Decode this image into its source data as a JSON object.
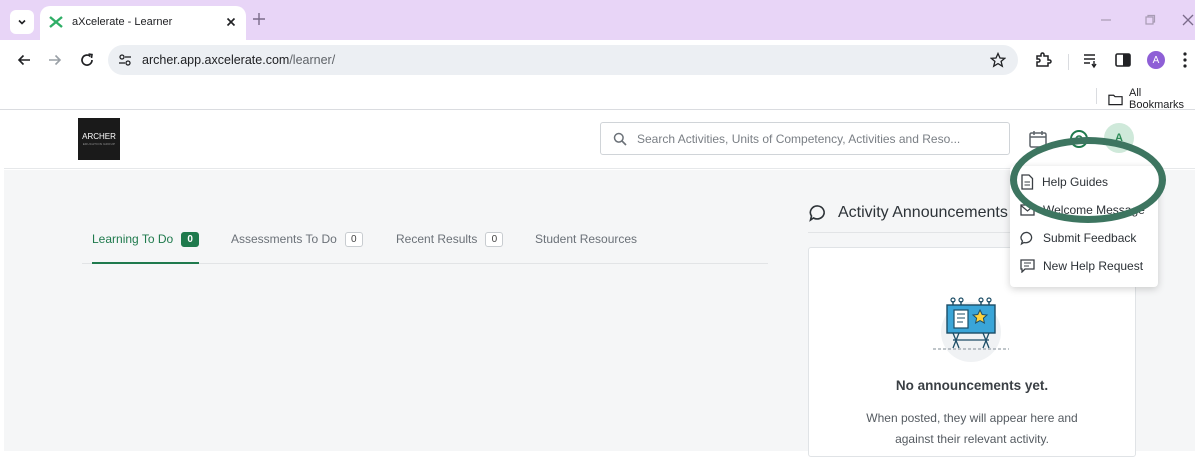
{
  "browser": {
    "tab_title": "aXcelerate - Learner",
    "url_host": "archer.app.axcelerate.com",
    "url_path": "/learner/",
    "profile_initial": "A",
    "bookmarks_label": "All Bookmarks"
  },
  "header": {
    "logo_text": "ARCHER",
    "logo_subtext": "EDUCATION GROUP",
    "search_placeholder": "Search Activities, Units of Competency, Activities and Reso...",
    "avatar_initial": "A"
  },
  "tabs": [
    {
      "label": "Learning To Do",
      "count": "0",
      "active": true
    },
    {
      "label": "Assessments To Do",
      "count": "0",
      "active": false
    },
    {
      "label": "Recent Results",
      "count": "0",
      "active": false
    },
    {
      "label": "Student Resources",
      "active": false
    }
  ],
  "announcements": {
    "title": "Activity Announcements",
    "empty_title": "No announcements yet.",
    "empty_desc": "When posted, they will appear here and against their relevant activity."
  },
  "help_menu": {
    "items": [
      {
        "label": "Help Guides",
        "icon": "document-icon"
      },
      {
        "label": "Welcome Message",
        "icon": "envelope-icon"
      },
      {
        "label": "Submit Feedback",
        "icon": "speech-bubble-icon"
      },
      {
        "label": "New Help Request",
        "icon": "message-icon"
      }
    ]
  },
  "colors": {
    "accent": "#1f7a4d",
    "tab_strip": "#e8d5f7",
    "highlight_ring": "#3d7560"
  }
}
